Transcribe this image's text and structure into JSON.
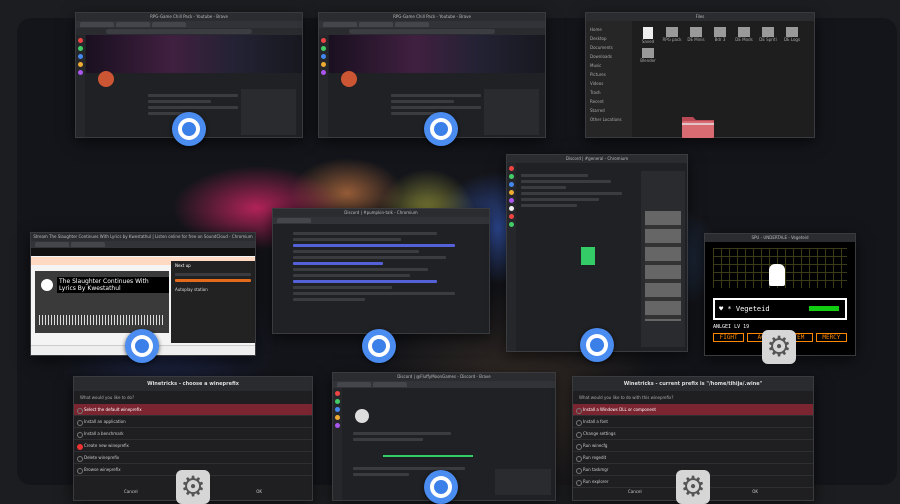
{
  "windows": {
    "yt_top_left": {
      "title": "RPG-Game Chill Pack - Youtube - Brave"
    },
    "yt_top_center": {
      "title": "RPG-Game Chill Pack - Youtube - Brave"
    },
    "files": {
      "title": "Files",
      "sidebar": [
        "Home",
        "Desktop",
        "Documents",
        "Downloads",
        "Music",
        "Pictures",
        "Videos",
        "Trash",
        "Recent",
        "Starred",
        "Other Locations"
      ],
      "files": [
        "Saved",
        "RPG pack",
        "DE Minis",
        "Bdr 3",
        "DE Mods",
        "DE Spriti",
        "DE Logs",
        "Blender"
      ]
    },
    "soundcloud": {
      "title": "Stream The Slaughter Continues With Lyrics by Kwestathul | Listen online for free on SoundCloud - Chromium",
      "logo": "SOUNDCLOUD",
      "track_title": "The Slaughter Continues With Lyrics By Kwestathul",
      "next_up": "Next up",
      "clear": "Clear",
      "autoplay": "Autoplay station"
    },
    "chat_center": {
      "title": "Discord | #pumpkin-talk - Chromium"
    },
    "discord_right": {
      "title": "Discord | #general - Chromium"
    },
    "game": {
      "title": "SPU - UNDERTALE - Vegeteid",
      "enemy_name": "♥ * Vegeteid",
      "buttons": [
        "FIGHT",
        "ACT",
        "ITEM",
        "MERCY"
      ],
      "level": "ANLGEI   LV 19"
    },
    "winetricks_left": {
      "title": "Winetricks - choose a wineprefix",
      "question": "What would you like to do?",
      "options": [
        "Select the default wineprefix",
        "Install an application",
        "Install a benchmark",
        "Create new wineprefix",
        "Delete wineprefix",
        "Browse wineprefix"
      ],
      "cancel": "Cancel",
      "ok": "OK"
    },
    "discord_bottom": {
      "title": "Discord | @FluffyMoonGames - Discord - Brave"
    },
    "winetricks_right": {
      "title": "Winetricks - current prefix is \"/home/tihija/.wine\"",
      "question": "What would you like to do with this wineprefix?",
      "options": [
        "Install a Windows DLL or component",
        "Install a font",
        "Change settings",
        "Run winecfg",
        "Run regedit",
        "Run taskmgr",
        "Run explorer"
      ],
      "cancel": "Cancel",
      "ok": "OK"
    }
  },
  "colors": {
    "chromium_blue": "#4a8cf0",
    "folder_red": "#d86a72",
    "selection_red": "#7a2530"
  }
}
